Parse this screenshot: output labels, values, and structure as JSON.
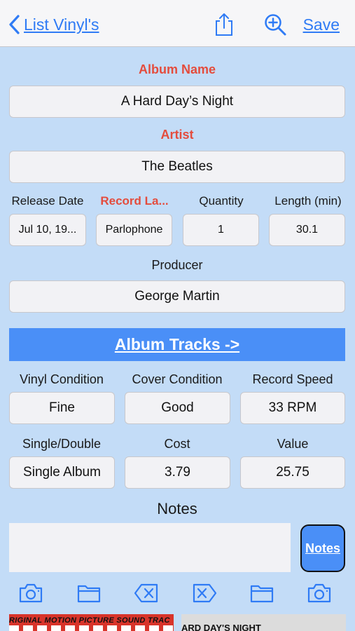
{
  "nav": {
    "back_label": "List Vinyl's",
    "save_label": "Save",
    "share_icon": "share-icon",
    "zoom_icon": "zoom-in-icon",
    "accent": "#2f7bf5"
  },
  "album": {
    "name_label": "Album Name",
    "name_value": "A Hard Day’s Night",
    "artist_label": "Artist",
    "artist_value": "The Beatles"
  },
  "details": {
    "release_label": "Release Date",
    "release_value": "Jul 10, 19...",
    "label_label": "Record La...",
    "label_value": "Parlophone",
    "quantity_label": "Quantity",
    "quantity_value": "1",
    "length_label": "Length (min)",
    "length_value": "30.1"
  },
  "producer": {
    "label": "Producer",
    "value": "George Martin"
  },
  "tracks_button": "Album Tracks ->",
  "condition": {
    "vinyl_label": "Vinyl Condition",
    "vinyl_value": "Fine",
    "cover_label": "Cover Condition",
    "cover_value": "Good",
    "speed_label": "Record Speed",
    "speed_value": "33 RPM"
  },
  "pricing": {
    "type_label": "Single/Double",
    "type_value": "Single Album",
    "cost_label": "Cost",
    "cost_value": "3.79",
    "value_label": "Value",
    "value_value": "25.75"
  },
  "notes": {
    "label": "Notes",
    "value": "",
    "button_label": "Notes"
  },
  "toolbar": {
    "icons": [
      "camera-icon",
      "folder-icon",
      "delete-icon",
      "clear-icon",
      "folder-icon",
      "camera-icon"
    ]
  },
  "covers": {
    "left_text": "RIGINAL MOTION PICTURE SOUND TRAC",
    "right_text": "ARD DAY'S NIGHT"
  },
  "colors": {
    "background": "#c3dcf7",
    "button_blue": "#4a8ff7",
    "required_red": "#e44c3d"
  }
}
